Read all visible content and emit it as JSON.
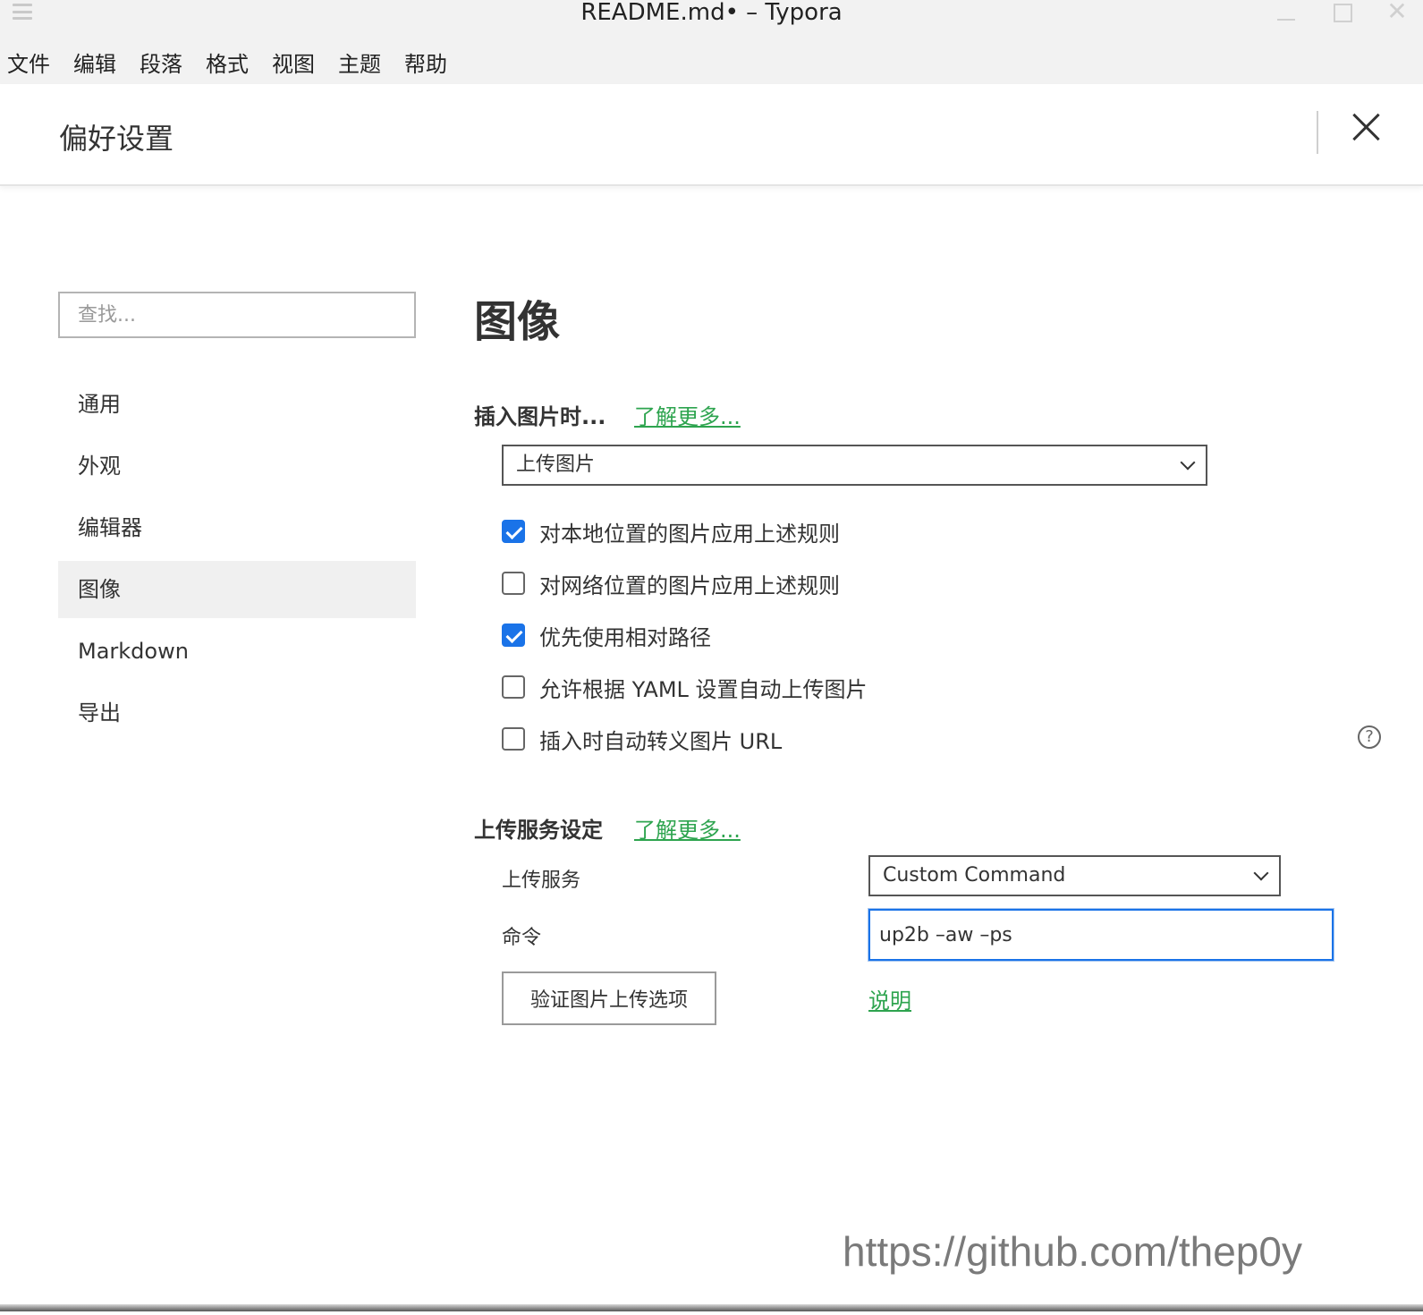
{
  "window": {
    "title": "README.md• – Typora"
  },
  "menu": [
    "文件",
    "编辑",
    "段落",
    "格式",
    "视图",
    "主题",
    "帮助"
  ],
  "preferences": {
    "title": "偏好设置"
  },
  "sidebar": {
    "search_placeholder": "查找...",
    "items": [
      {
        "label": "通用",
        "active": false
      },
      {
        "label": "外观",
        "active": false
      },
      {
        "label": "编辑器",
        "active": false
      },
      {
        "label": "图像",
        "active": true
      },
      {
        "label": "Markdown",
        "active": false
      },
      {
        "label": "导出",
        "active": false
      }
    ]
  },
  "main": {
    "title": "图像",
    "insert": {
      "title": "插入图片时...",
      "learn_more": "了解更多...",
      "action_selected": "上传图片",
      "options": [
        {
          "label": "对本地位置的图片应用上述规则",
          "checked": true
        },
        {
          "label": "对网络位置的图片应用上述规则",
          "checked": false
        },
        {
          "label": "优先使用相对路径",
          "checked": true
        },
        {
          "label": "允许根据 YAML 设置自动上传图片",
          "checked": false
        },
        {
          "label": "插入时自动转义图片 URL",
          "checked": false
        }
      ],
      "help_symbol": "?"
    },
    "upload": {
      "title": "上传服务设定",
      "learn_more": "了解更多...",
      "service_label": "上传服务",
      "service_selected": "Custom Command",
      "command_label": "命令",
      "command_value": "up2b –aw –ps",
      "verify_button": "验证图片上传选项",
      "explain_link": "说明"
    }
  },
  "watermark": "https://github.com/thep0y",
  "colors": {
    "accent": "#1a73e8",
    "link": "#2ea44f",
    "active_bg": "#f0f0f0"
  }
}
